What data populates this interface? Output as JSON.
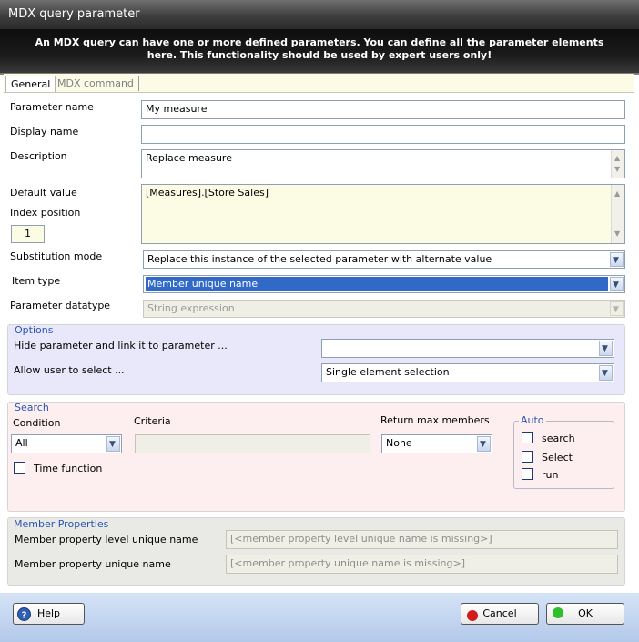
{
  "window": {
    "title": "MDX query parameter"
  },
  "banner": {
    "text": "An MDX query can have one or more defined parameters. You can define all the parameter elements here. This functionality should be used by expert users only!"
  },
  "tabs": [
    {
      "label": "General",
      "active": true
    },
    {
      "label": "MDX command",
      "active": false
    }
  ],
  "form": {
    "parameter_name": {
      "label": "Parameter name",
      "value": "My measure"
    },
    "display_name": {
      "label": "Display name",
      "value": ""
    },
    "description": {
      "label": "Description",
      "value": "Replace measure"
    },
    "default_value": {
      "label": "Default value",
      "value": "[Measures].[Store Sales]"
    },
    "index_position": {
      "label": "Index position",
      "value": "1"
    },
    "substitution_mode": {
      "label": "Substitution mode",
      "value": "Replace this instance of the selected parameter with alternate value"
    },
    "item_type": {
      "label": "Item type",
      "value": "Member unique name"
    },
    "parameter_datatype": {
      "label": "Parameter datatype",
      "value": "String expression"
    }
  },
  "options": {
    "title": "Options",
    "hide_label": "Hide parameter and link it to parameter ...",
    "hide_value": "",
    "allow_label": "Allow user to select ...",
    "allow_value": "Single element selection"
  },
  "search": {
    "title": "Search",
    "condition_label": "Condition",
    "condition_value": "All",
    "criteria_label": "Criteria",
    "criteria_value": "",
    "return_max_label": "Return max members",
    "return_max_value": "None",
    "time_function_label": "Time function",
    "auto": {
      "title": "Auto",
      "search_label": "search",
      "select_label": "Select",
      "run_label": "run"
    }
  },
  "member_properties": {
    "title": "Member Properties",
    "level_label": "Member property level unique name",
    "level_value": "[<member property level unique name is missing>]",
    "unique_label": "Member property unique name",
    "unique_value": "[<member property unique name is missing>]"
  },
  "buttons": {
    "help": "Help",
    "cancel": "Cancel",
    "ok": "OK"
  },
  "colors": {
    "selection": "#3169c6",
    "group_title": "#2c55b3",
    "ok_indicator": "#2fbf2a",
    "cancel_indicator": "#d21b1b"
  }
}
